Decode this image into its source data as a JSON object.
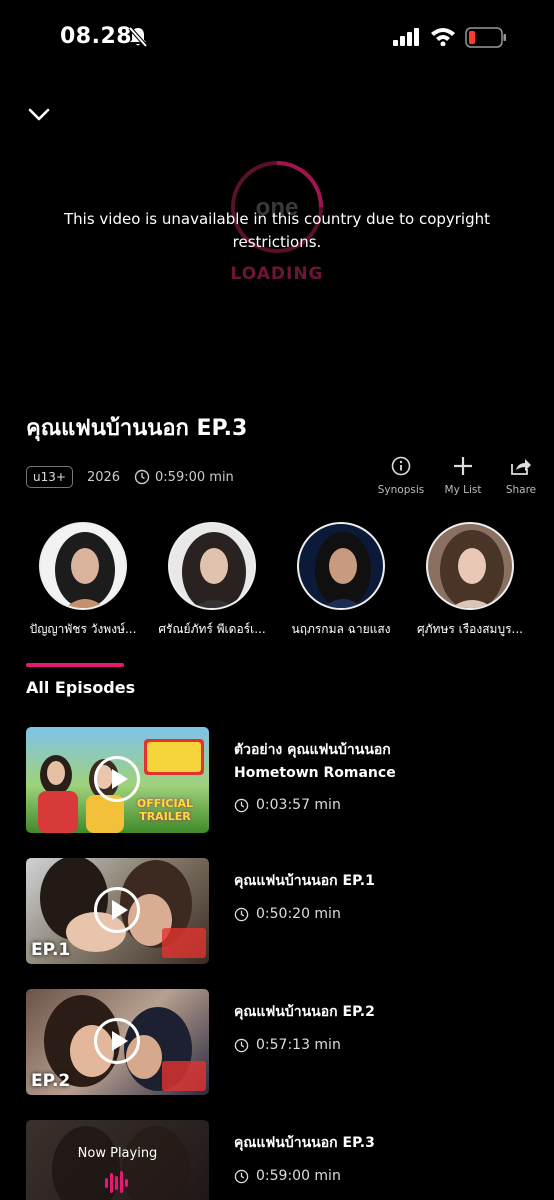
{
  "status": {
    "time": "08.28"
  },
  "player": {
    "loading_text": "LOADING",
    "message": "This video is unavailable in this country due to copyright restrictions."
  },
  "show": {
    "title": "คุณแฟนบ้านนอก EP.3",
    "rating": "u13+",
    "year": "2026",
    "duration": "0:59:00 min"
  },
  "actions": [
    {
      "label": "Synopsis",
      "icon": "info-icon"
    },
    {
      "label": "My List",
      "icon": "plus-icon"
    },
    {
      "label": "Share",
      "icon": "share-icon"
    }
  ],
  "cast": [
    {
      "name": "ปัญญาพัชร วังพงษ์..."
    },
    {
      "name": "ศรัณย์ภัทร์ พีเดอร์เ..."
    },
    {
      "name": "นฤภรกมล ฉายแสง"
    },
    {
      "name": "ศุภัทษร เรืองสมบูร..."
    }
  ],
  "episodes_section": {
    "title": "All Episodes"
  },
  "episodes": [
    {
      "title_line1": "ตัวอย่าง คุณแฟนบ้านนอก",
      "title_line2": "Hometown Romance",
      "duration": "0:03:57 min",
      "badge": "",
      "thumb_text": "OFFICIAL TRAILER"
    },
    {
      "title_line1": "คุณแฟนบ้านนอก EP.1",
      "title_line2": "",
      "duration": "0:50:20 min",
      "badge": "EP.1"
    },
    {
      "title_line1": "คุณแฟนบ้านนอก EP.2",
      "title_line2": "",
      "duration": "0:57:13 min",
      "badge": "EP.2"
    },
    {
      "title_line1": "คุณแฟนบ้านนอก EP.3",
      "title_line2": "",
      "duration": "0:59:00 min",
      "badge": "",
      "now_playing": "Now Playing"
    }
  ],
  "colors": {
    "accent": "#e6186f",
    "battery_low": "#ff3b30"
  }
}
